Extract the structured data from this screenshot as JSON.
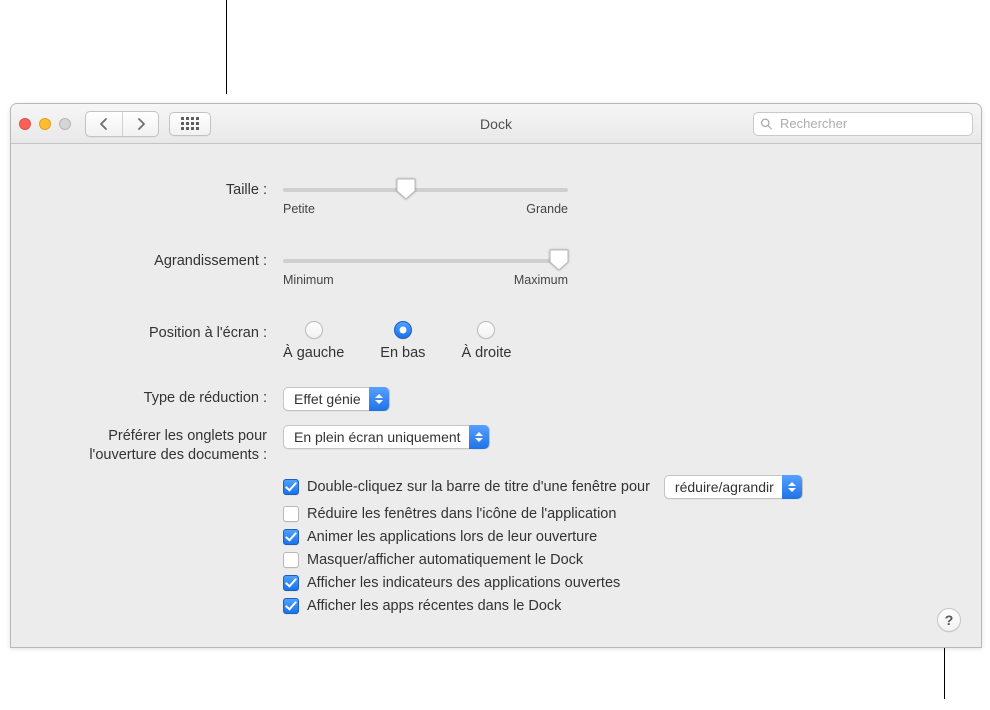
{
  "window": {
    "title": "Dock",
    "search_placeholder": "Rechercher"
  },
  "size": {
    "label": "Taille :",
    "min_label": "Petite",
    "max_label": "Grande",
    "value_percent": 43
  },
  "magnification": {
    "label": "Agrandissement :",
    "enabled": false,
    "min_label": "Minimum",
    "max_label": "Maximum",
    "value_percent": 97
  },
  "position": {
    "label": "Position à l'écran :",
    "options": [
      {
        "key": "left",
        "label": "À gauche",
        "checked": false
      },
      {
        "key": "bottom",
        "label": "En bas",
        "checked": true
      },
      {
        "key": "right",
        "label": "À droite",
        "checked": false
      }
    ]
  },
  "minimize_effect": {
    "label": "Type de réduction :",
    "value": "Effet génie"
  },
  "prefer_tabs": {
    "label_line1": "Préférer les onglets pour",
    "label_line2": "l'ouverture des documents :",
    "value": "En plein écran uniquement"
  },
  "options": {
    "double_click_label": "Double-cliquez sur la barre de titre d'une fenêtre pour",
    "double_click_action": "réduire/agrandir",
    "items": [
      {
        "key": "double_click",
        "label_bind": "options.double_click_label",
        "checked": true,
        "has_popup": true
      },
      {
        "key": "minimize_into_icon",
        "label": "Réduire les fenêtres dans l'icône de l'application",
        "checked": false
      },
      {
        "key": "animate_open",
        "label": "Animer les applications lors de leur ouverture",
        "checked": true
      },
      {
        "key": "autohide",
        "label": "Masquer/afficher automatiquement le Dock",
        "checked": false
      },
      {
        "key": "indicators",
        "label": "Afficher les indicateurs des applications ouvertes",
        "checked": true
      },
      {
        "key": "recent_apps",
        "label": "Afficher les apps récentes dans le Dock",
        "checked": true
      }
    ]
  },
  "help_glyph": "?"
}
